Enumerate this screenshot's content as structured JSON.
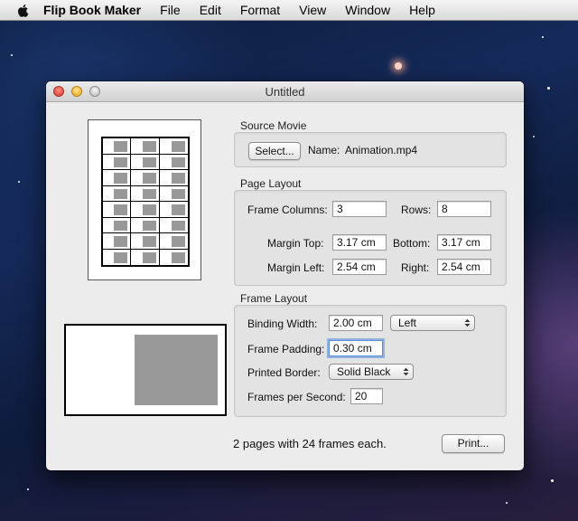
{
  "menubar": {
    "app_name": "Flip Book Maker",
    "items": [
      "File",
      "Edit",
      "Format",
      "View",
      "Window",
      "Help"
    ]
  },
  "window": {
    "title": "Untitled"
  },
  "source_movie": {
    "group_label": "Source Movie",
    "select_button": "Select...",
    "name_label": "Name:",
    "name_value": "Animation.mp4"
  },
  "page_layout": {
    "group_label": "Page Layout",
    "frame_columns_label": "Frame Columns:",
    "frame_columns_value": "3",
    "rows_label": "Rows:",
    "rows_value": "8",
    "margin_top_label": "Margin Top:",
    "margin_top_value": "3.17 cm",
    "bottom_label": "Bottom:",
    "bottom_value": "3.17 cm",
    "margin_left_label": "Margin Left:",
    "margin_left_value": "2.54 cm",
    "right_label": "Right:",
    "right_value": "2.54 cm"
  },
  "frame_layout": {
    "group_label": "Frame Layout",
    "binding_width_label": "Binding Width:",
    "binding_width_value": "2.00 cm",
    "binding_side_selected": "Left",
    "frame_padding_label": "Frame Padding:",
    "frame_padding_value": "0.30 cm",
    "printed_border_label": "Printed Border:",
    "printed_border_selected": "Solid Black",
    "fps_label": "Frames per Second:",
    "fps_value": "20"
  },
  "footer": {
    "status": "2 pages with 24 frames each.",
    "print_button": "Print..."
  },
  "preview": {
    "frames_per_page": 24
  }
}
